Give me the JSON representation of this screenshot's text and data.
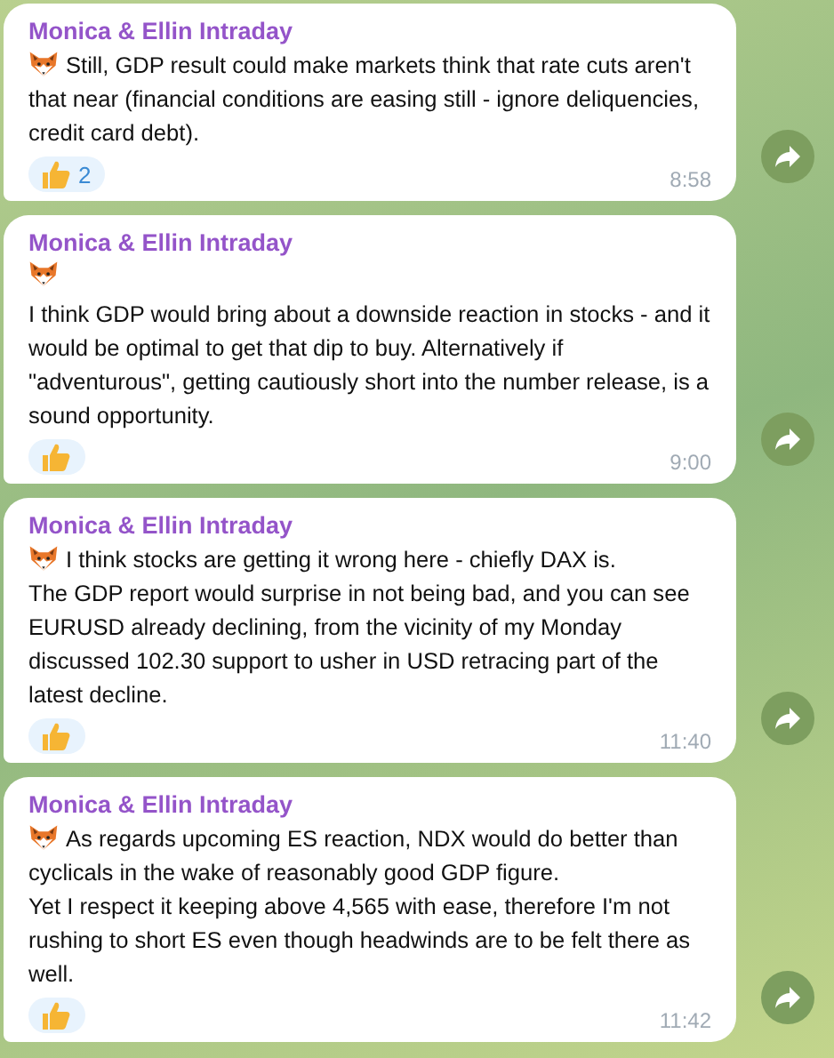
{
  "messages": [
    {
      "sender": "Monica & Ellin Intraday",
      "blocks": [
        {
          "kind": "fox_text",
          "text": "Still, GDP result could make markets think that rate cuts aren't that near (financial conditions are easing still - ignore deliquencies, credit card debt)."
        }
      ],
      "reaction": {
        "kind": "thumbs_up",
        "count": "2"
      },
      "time": "8:58"
    },
    {
      "sender": "Monica & Ellin Intraday",
      "blocks": [
        {
          "kind": "fox"
        },
        {
          "kind": "text",
          "text": "I think GDP would bring about a downside reaction in stocks - and it would be optimal to get that dip to buy. Alternatively if \"adventurous\", getting cautiously short into the number release, is a sound opportunity."
        }
      ],
      "reaction": {
        "kind": "thumbs_up"
      },
      "time": "9:00"
    },
    {
      "sender": "Monica & Ellin Intraday",
      "blocks": [
        {
          "kind": "fox_text",
          "text": "I think stocks are getting it wrong here - chiefly DAX is."
        },
        {
          "kind": "text",
          "text": "The GDP report would surprise in not being bad, and you can see EURUSD already declining, from the vicinity of my Monday discussed 102.30 support to usher in USD retracing part of the latest decline."
        }
      ],
      "reaction": {
        "kind": "thumbs_up"
      },
      "time": "11:40"
    },
    {
      "sender": "Monica & Ellin Intraday",
      "blocks": [
        {
          "kind": "fox_text",
          "text": "As regards upcoming ES reaction, NDX would do better than cyclicals in the wake of reasonably good GDP figure."
        },
        {
          "kind": "text",
          "text": "Yet I respect it keeping above 4,565 with ease, therefore I'm not rushing to short ES even though headwinds are to be felt there as well."
        }
      ],
      "reaction": {
        "kind": "thumbs_up"
      },
      "time": "11:42"
    }
  ]
}
